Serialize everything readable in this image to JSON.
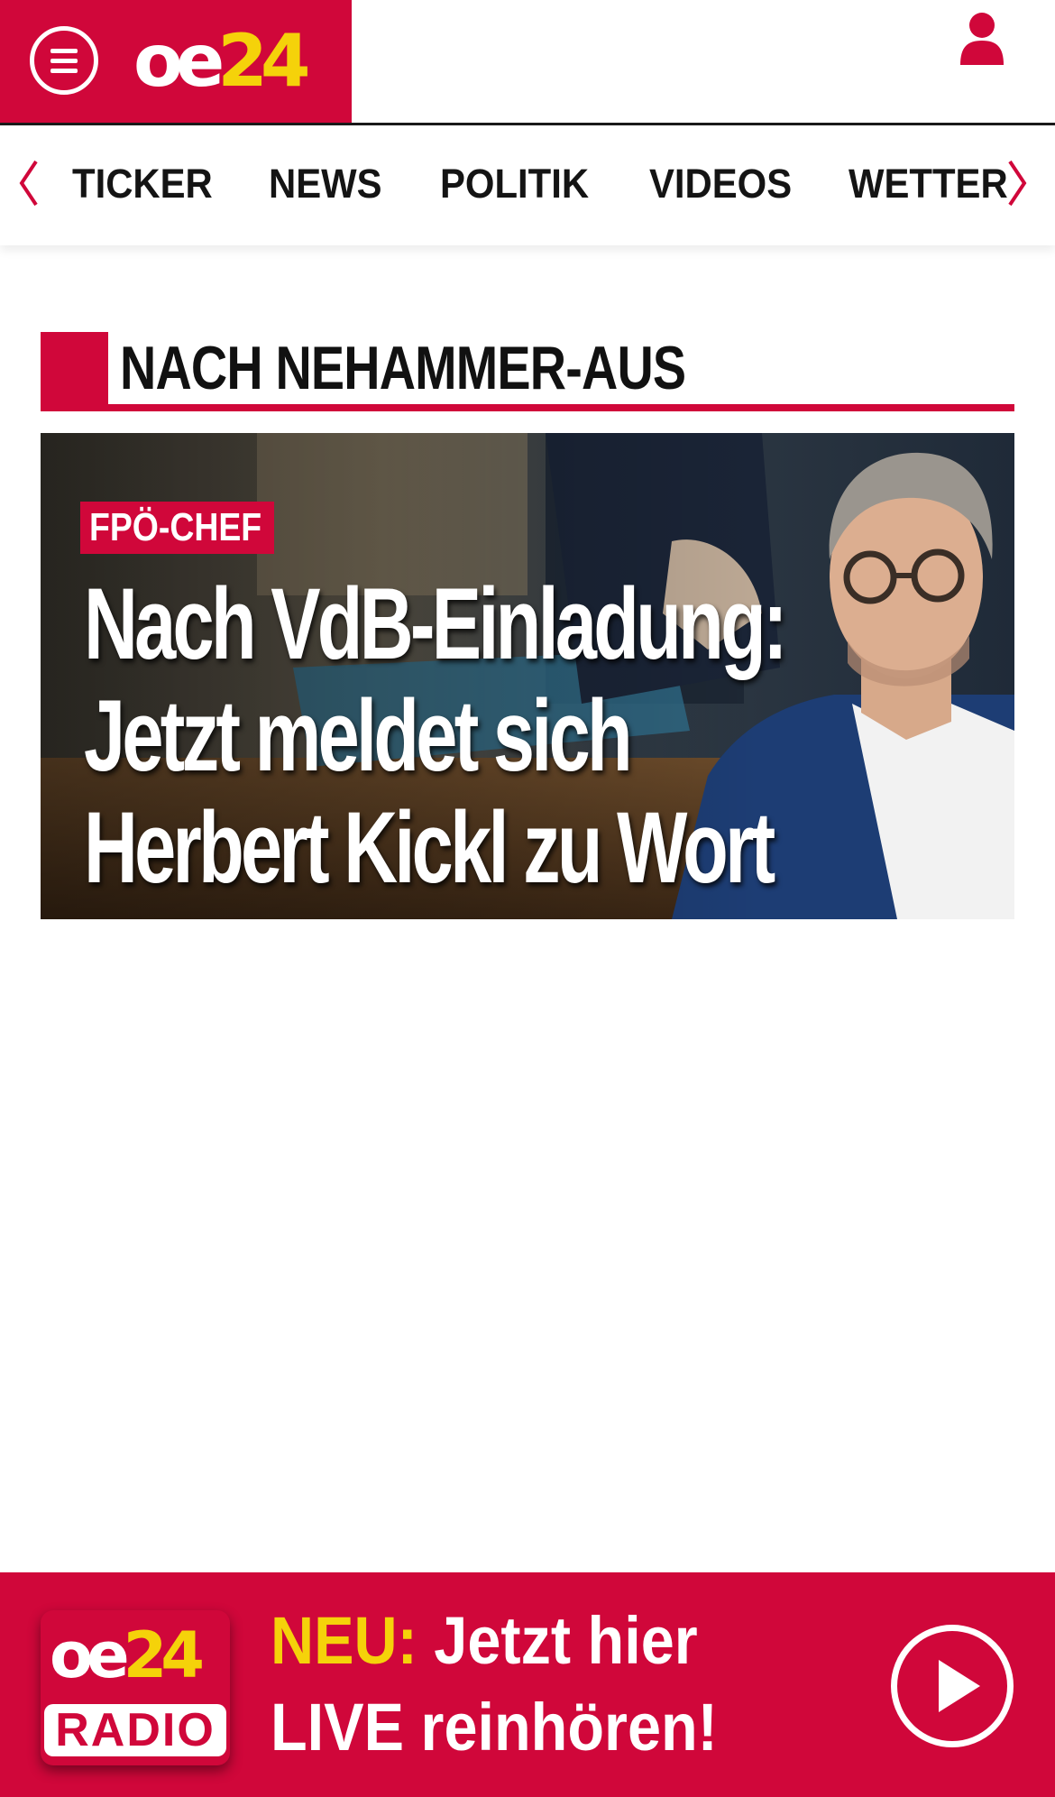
{
  "header": {
    "logo_oe": "oe",
    "logo_24": "24",
    "brand_color": "#d0073a",
    "accent_color": "#f5d20a",
    "menu_icon": "hamburger-menu-icon",
    "user_icon": "user-icon"
  },
  "nav": {
    "items": [
      {
        "label": "TICKER"
      },
      {
        "label": "NEWS"
      },
      {
        "label": "POLITIK"
      },
      {
        "label": "VIDEOS"
      },
      {
        "label": "WETTER"
      }
    ],
    "prev_icon": "chevron-left-icon",
    "next_icon": "chevron-right-icon"
  },
  "section": {
    "title": "NACH NEHAMMER-AUS"
  },
  "teaser": {
    "kicker": "FPÖ-CHEF",
    "headline_lines": [
      "Nach VdB-Einladung:",
      "Jetzt meldet sich",
      "Herbert Kickl zu Wort"
    ]
  },
  "radio_banner": {
    "logo_oe": "oe",
    "logo_24": "24",
    "logo_radio": "RADIO",
    "neu": "NEU:",
    "line1_rest": " Jetzt hier",
    "line2": "LIVE reinhören!",
    "play_icon": "play-icon"
  }
}
